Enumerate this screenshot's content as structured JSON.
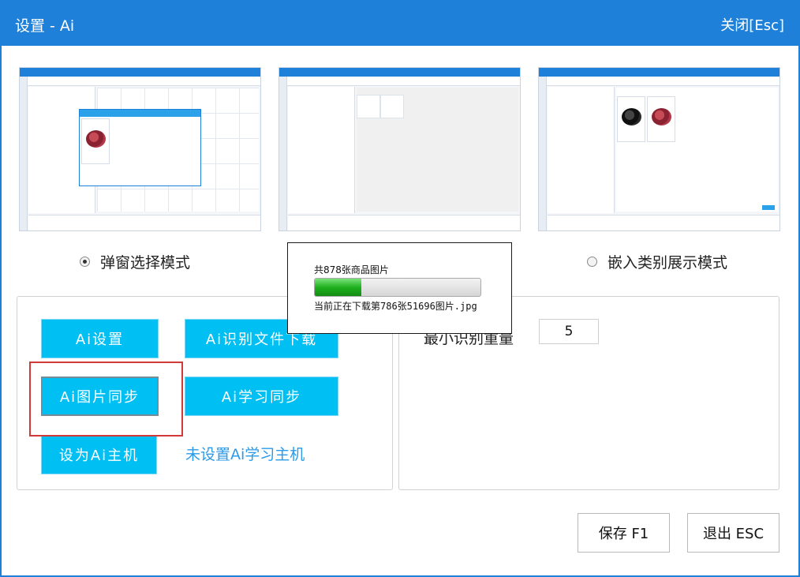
{
  "window": {
    "title": "设置 - Ai",
    "close_label": "关闭[Esc]"
  },
  "modes": [
    {
      "label": "弹窗选择模式",
      "checked": true
    },
    {
      "label": "嵌入类别展示模式",
      "checked": false
    }
  ],
  "left_panel": {
    "ai_settings": "Ai设置",
    "ai_file_download": "Ai识别文件下载",
    "ai_image_sync": "Ai图片同步",
    "ai_learn_sync": "Ai学习同步",
    "set_main_host": "设为Ai主机",
    "host_status": "未设置Ai学习主机"
  },
  "right_panel": {
    "min_recognition_label": "最小识别重量",
    "min_recognition_value": "5"
  },
  "progress_dialog": {
    "total_text": "共878张商品图片",
    "current_text": "当前正在下载第786张51696图片.jpg",
    "progress_fraction": 0.28
  },
  "footer": {
    "save_label": "保存 F1",
    "exit_label": "退出 ESC"
  },
  "colors": {
    "title_bar": "#1e80d8",
    "button_bg": "#00bff3",
    "host_status": "#2b9ae8",
    "highlight_box": "#d23a3a",
    "progress_fill": "#1fb01f"
  }
}
